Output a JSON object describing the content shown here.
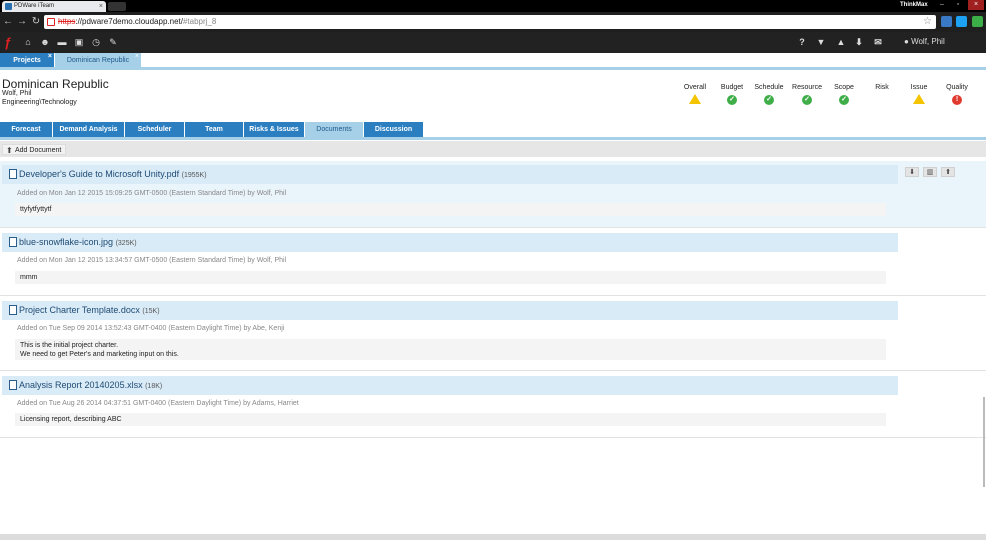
{
  "browser": {
    "tab_title": "PDWare iTeam",
    "brand": "ThinkMax",
    "url_scheme": "https",
    "url_host": "://pdware7demo.cloudapp.net/",
    "url_hash": "#tabprj_8"
  },
  "app": {
    "logo": "ƒ",
    "user_name": "Wolf, Phil"
  },
  "top_tabs": [
    {
      "label": "Projects"
    },
    {
      "label": "Dominican Republic"
    }
  ],
  "project": {
    "title": "Dominican Republic",
    "owner": "Wolf, Phil",
    "department": "Engineering\\Technology"
  },
  "health": [
    {
      "label": "Overall",
      "status": "warning"
    },
    {
      "label": "Budget",
      "status": "ok"
    },
    {
      "label": "Schedule",
      "status": "ok"
    },
    {
      "label": "Resource",
      "status": "ok"
    },
    {
      "label": "Scope",
      "status": "ok"
    },
    {
      "label": "Risk",
      "status": "none"
    },
    {
      "label": "Issue",
      "status": "warning"
    },
    {
      "label": "Quality",
      "status": "critical"
    }
  ],
  "project_tabs": [
    {
      "label": "Forecast"
    },
    {
      "label": "Demand Analysis"
    },
    {
      "label": "Scheduler"
    },
    {
      "label": "Team"
    },
    {
      "label": "Risks & Issues"
    },
    {
      "label": "Documents"
    },
    {
      "label": "Discussion"
    }
  ],
  "toolbar": {
    "add_document": "Add Document"
  },
  "documents": [
    {
      "name": "Developer's Guide to Microsoft Unity.pdf",
      "size": "(1955K)",
      "added": "Added on Mon Jan 12 2015 15:09:25 GMT-0500 (Eastern Standard Time) by Wolf, Phil",
      "note_1": "ttyfytfyttytf",
      "note_2": ""
    },
    {
      "name": "blue-snowflake-icon.jpg",
      "size": "(325K)",
      "added": "Added on Mon Jan 12 2015 13:34:57 GMT-0500 (Eastern Standard Time) by Wolf, Phil",
      "note_1": "mmm",
      "note_2": ""
    },
    {
      "name": "Project Charter Template.docx",
      "size": "(15K)",
      "added": "Added on Tue Sep 09 2014 13:52:43 GMT-0400 (Eastern Daylight Time) by Abe, Kenji",
      "note_1": "This is the initial project charter.",
      "note_2": "We need to get Peter's and marketing input on this."
    },
    {
      "name": "Analysis Report 20140205.xlsx",
      "size": "(18K)",
      "added": "Added on Tue Aug 26 2014 04:37:51 GMT-0400 (Eastern Daylight Time) by Adams, Harriet",
      "note_1": "Licensing report, describing ABC",
      "note_2": ""
    }
  ],
  "colors": {
    "accent": "#2b7fc1",
    "tab_active": "#a6cfe8",
    "ok": "#3fae49",
    "warning": "#f5c400",
    "critical": "#e03a2f"
  }
}
